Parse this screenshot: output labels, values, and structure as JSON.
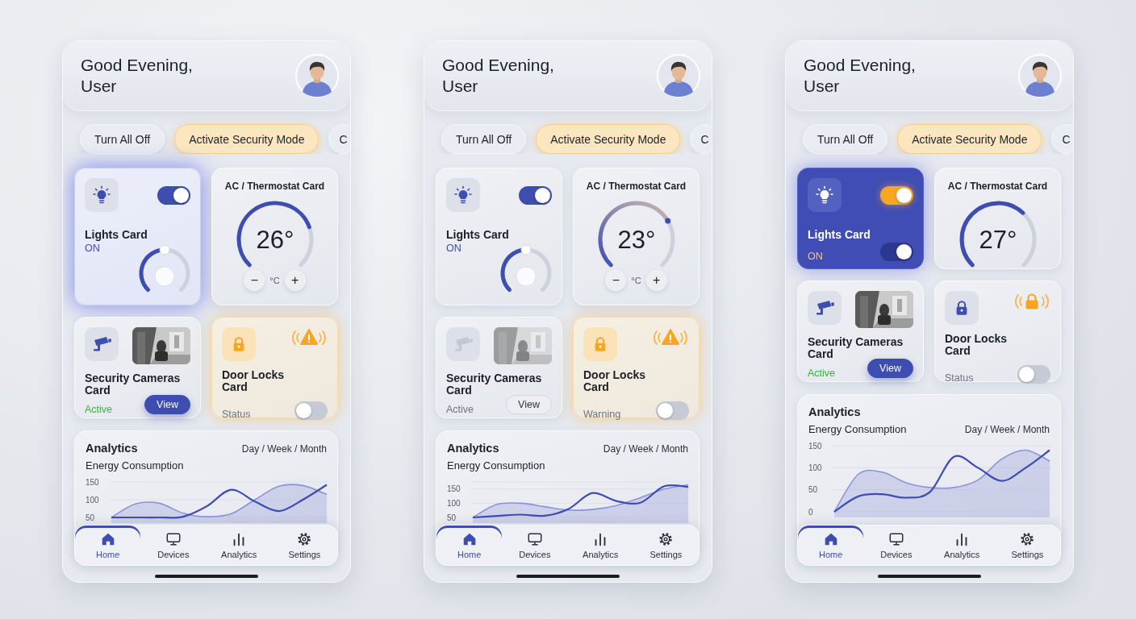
{
  "phones": [
    {
      "greeting": "Good Evening, User",
      "chips": [
        {
          "label": "Turn All Off",
          "highlighted": false
        },
        {
          "label": "Activate Security Mode",
          "highlighted": true
        },
        {
          "label": "C",
          "highlighted": false
        }
      ],
      "lights": {
        "title": "Lights Card",
        "status": "ON",
        "on": true,
        "glow": true,
        "filled": false,
        "kind": "dial"
      },
      "thermostat": {
        "title": "AC / Thermostat Card",
        "temperature": "26°",
        "gradient": false,
        "decrease": "−",
        "unit": "°C",
        "increase": "+"
      },
      "cameras": {
        "title": "Security Cameras Card",
        "status": "Active",
        "enabled": true,
        "button": "View"
      },
      "door": {
        "title": "Door Locks Card",
        "status": "Status",
        "alert": true,
        "on": false
      },
      "analytics": {
        "title": "Analytics",
        "periods": "Day / Week / Month",
        "subtitle": "Energy Consumption",
        "stacked": false,
        "chart_data": {
          "type": "area",
          "ylim": [
            50,
            150
          ],
          "yticks": [
            50,
            100,
            150
          ],
          "series": [
            {
              "color": "#8a93d6",
              "values": [
                50,
                88,
                90,
                62,
                52,
                60,
                100,
                138,
                140,
                115
              ]
            },
            {
              "type": "line",
              "color": "#3d4db0",
              "values": [
                50,
                50,
                50,
                52,
                82,
                128,
                95,
                68,
                100,
                142
              ]
            }
          ]
        }
      },
      "nav": [
        {
          "label": "Home",
          "selected": true
        },
        {
          "label": "Devices",
          "selected": false
        },
        {
          "label": "Analytics",
          "selected": false
        },
        {
          "label": "Settings",
          "selected": false
        }
      ]
    },
    {
      "greeting": "Good Evening, User",
      "chips": [
        {
          "label": "Turn All Off",
          "highlighted": false
        },
        {
          "label": "Activate Security Mode",
          "highlighted": true
        },
        {
          "label": "C",
          "highlighted": false
        }
      ],
      "lights": {
        "title": "Lights Card",
        "status": "ON",
        "on": true,
        "glow": false,
        "filled": false,
        "kind": "dial"
      },
      "thermostat": {
        "title": "AC / Thermostat Card",
        "temperature": "23°",
        "gradient": true,
        "decrease": "−",
        "unit": "°C",
        "increase": "+"
      },
      "cameras": {
        "title": "Security Cameras Card",
        "status": "Active",
        "enabled": false,
        "button": "View"
      },
      "door": {
        "title": "Door Locks Card",
        "status": "Warning",
        "alert": true,
        "on": false
      },
      "analytics": {
        "title": "Analytics",
        "periods": "Day / Week / Month",
        "subtitle": "Energy Consumption",
        "stacked": false,
        "chart_data": {
          "type": "area",
          "ylim": [
            50,
            175
          ],
          "yticks": [
            50,
            100,
            150
          ],
          "series": [
            {
              "color": "#8a93d6",
              "values": [
                50,
                96,
                100,
                88,
                76,
                78,
                92,
                120,
                150,
                165
              ]
            },
            {
              "type": "line",
              "color": "#3d4db0",
              "values": [
                50,
                55,
                60,
                56,
                80,
                136,
                108,
                102,
                160,
                158
              ]
            }
          ]
        }
      },
      "nav": [
        {
          "label": "Home",
          "selected": true
        },
        {
          "label": "Devices",
          "selected": false
        },
        {
          "label": "Analytics",
          "selected": false
        },
        {
          "label": "Settings",
          "selected": false
        }
      ]
    },
    {
      "greeting": "Good Evening, User",
      "chips": [
        {
          "label": "Turn All Off",
          "highlighted": false
        },
        {
          "label": "Activate Security Mode",
          "highlighted": true
        },
        {
          "label": "C",
          "highlighted": false
        }
      ],
      "lights": {
        "title": "Lights Card",
        "status": "ON",
        "on": true,
        "glow": true,
        "filled": true,
        "kind": "switch",
        "switch_on": true
      },
      "thermostat": {
        "title": "AC / Thermostat Card",
        "temperature": "27°",
        "gradient": false
      },
      "cameras": {
        "title": "Security Cameras Card",
        "status": "Active",
        "enabled": true,
        "button": "View"
      },
      "door": {
        "title": "Door Locks Card",
        "status": "Status",
        "alert": false,
        "on": false
      },
      "analytics": {
        "title": "Analytics",
        "subtitle": "Energy Consumption",
        "periods": "Day / Week / Month",
        "stacked": true,
        "chart_data": {
          "type": "area",
          "ylim": [
            0,
            150
          ],
          "yticks": [
            0,
            50,
            100,
            150
          ],
          "series": [
            {
              "color": "#8a93d6",
              "values": [
                0,
                85,
                90,
                66,
                55,
                55,
                72,
                120,
                140,
                115
              ]
            },
            {
              "type": "line",
              "color": "#3d4db0",
              "values": [
                0,
                35,
                40,
                32,
                45,
                125,
                100,
                70,
                100,
                140
              ]
            }
          ]
        }
      },
      "nav": [
        {
          "label": "Home",
          "selected": true
        },
        {
          "label": "Devices",
          "selected": false
        },
        {
          "label": "Analytics",
          "selected": false
        },
        {
          "label": "Settings",
          "selected": false
        }
      ]
    }
  ]
}
